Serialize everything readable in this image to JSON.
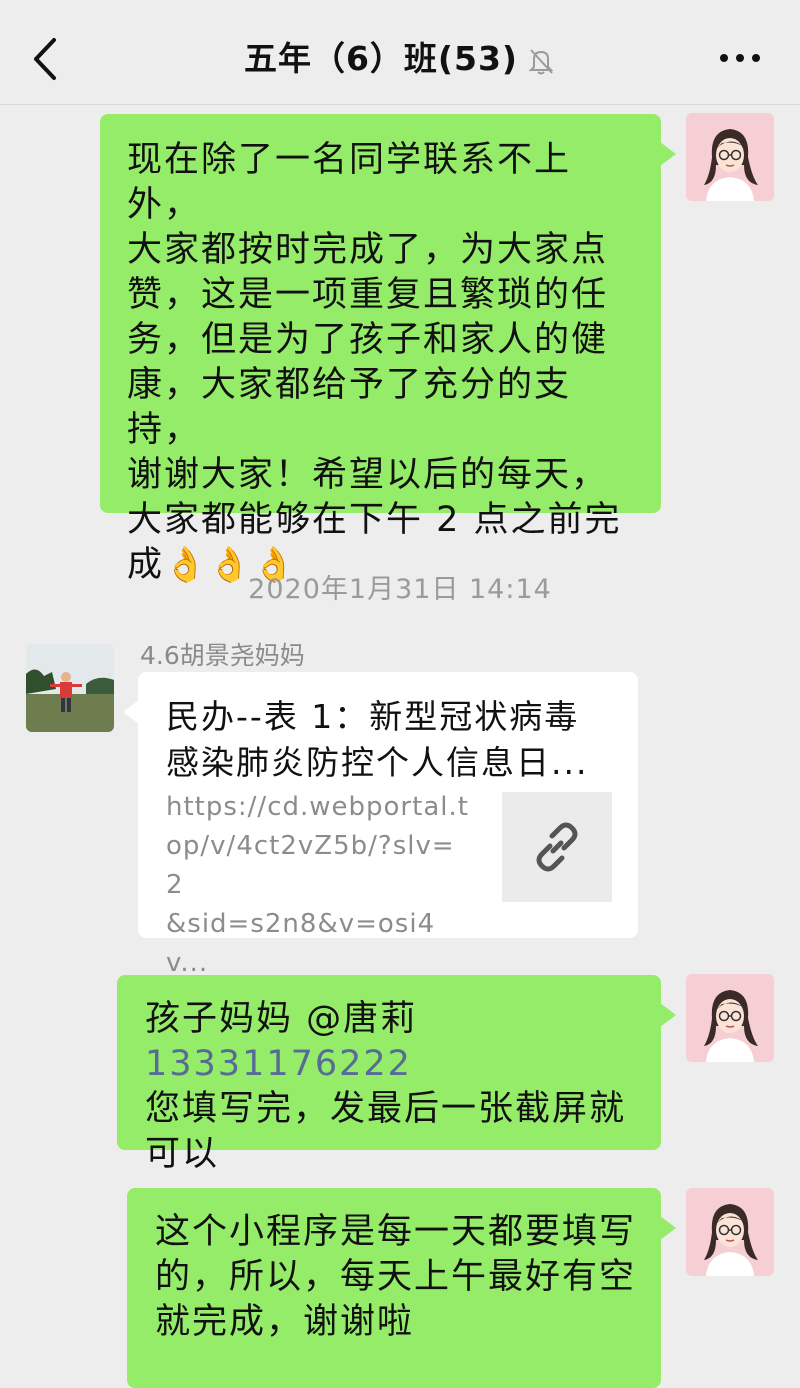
{
  "header": {
    "title": "五年（6）班(53)",
    "back_icon": "chevron-left-icon",
    "mute_icon": "bell-off-icon",
    "more_icon": "more-dots-icon"
  },
  "messages": {
    "m1": {
      "line1": "现在除了一名同学联系不上外，",
      "line2": "大家都按时完成了，为大家点",
      "line3": "赞，这是一项重复且繁琐的任",
      "line4": "务，但是为了孩子和家人的健",
      "line5": "康，大家都给予了充分的支持，",
      "line6": "谢谢大家！希望以后的每天，",
      "line7": "大家都能够在下午 2 点之前完",
      "line8": "成",
      "emoji": "👌👌👌"
    },
    "timestamp": "2020年1月31日 14:14",
    "m2": {
      "sender": "4.6胡景尧妈妈",
      "link_title_1": "民办--表 1：新型冠状病毒",
      "link_title_2": "感染肺炎防控个人信息日...",
      "url_1": "https://cd.webportal.t",
      "url_2": "op/v/4ct2vZ5b/?slv=2",
      "url_3": "&sid=s2n8&v=osi4v...",
      "thumb_icon": "link-icon"
    },
    "m3": {
      "prefix": "孩子妈妈 @唐莉",
      "phone": "13331176222",
      "line2": "您填写完，发最后一张截屏就",
      "line3": "可以"
    },
    "m4": {
      "line1": "这个小程序是每一天都要填写",
      "line2": "的，所以，每天上午最好有空",
      "line3": "就完成，谢谢啦"
    }
  },
  "colors": {
    "background": "#ededed",
    "bubble_self": "#95ec69",
    "bubble_other": "#ffffff",
    "phone_link": "#576b95"
  }
}
